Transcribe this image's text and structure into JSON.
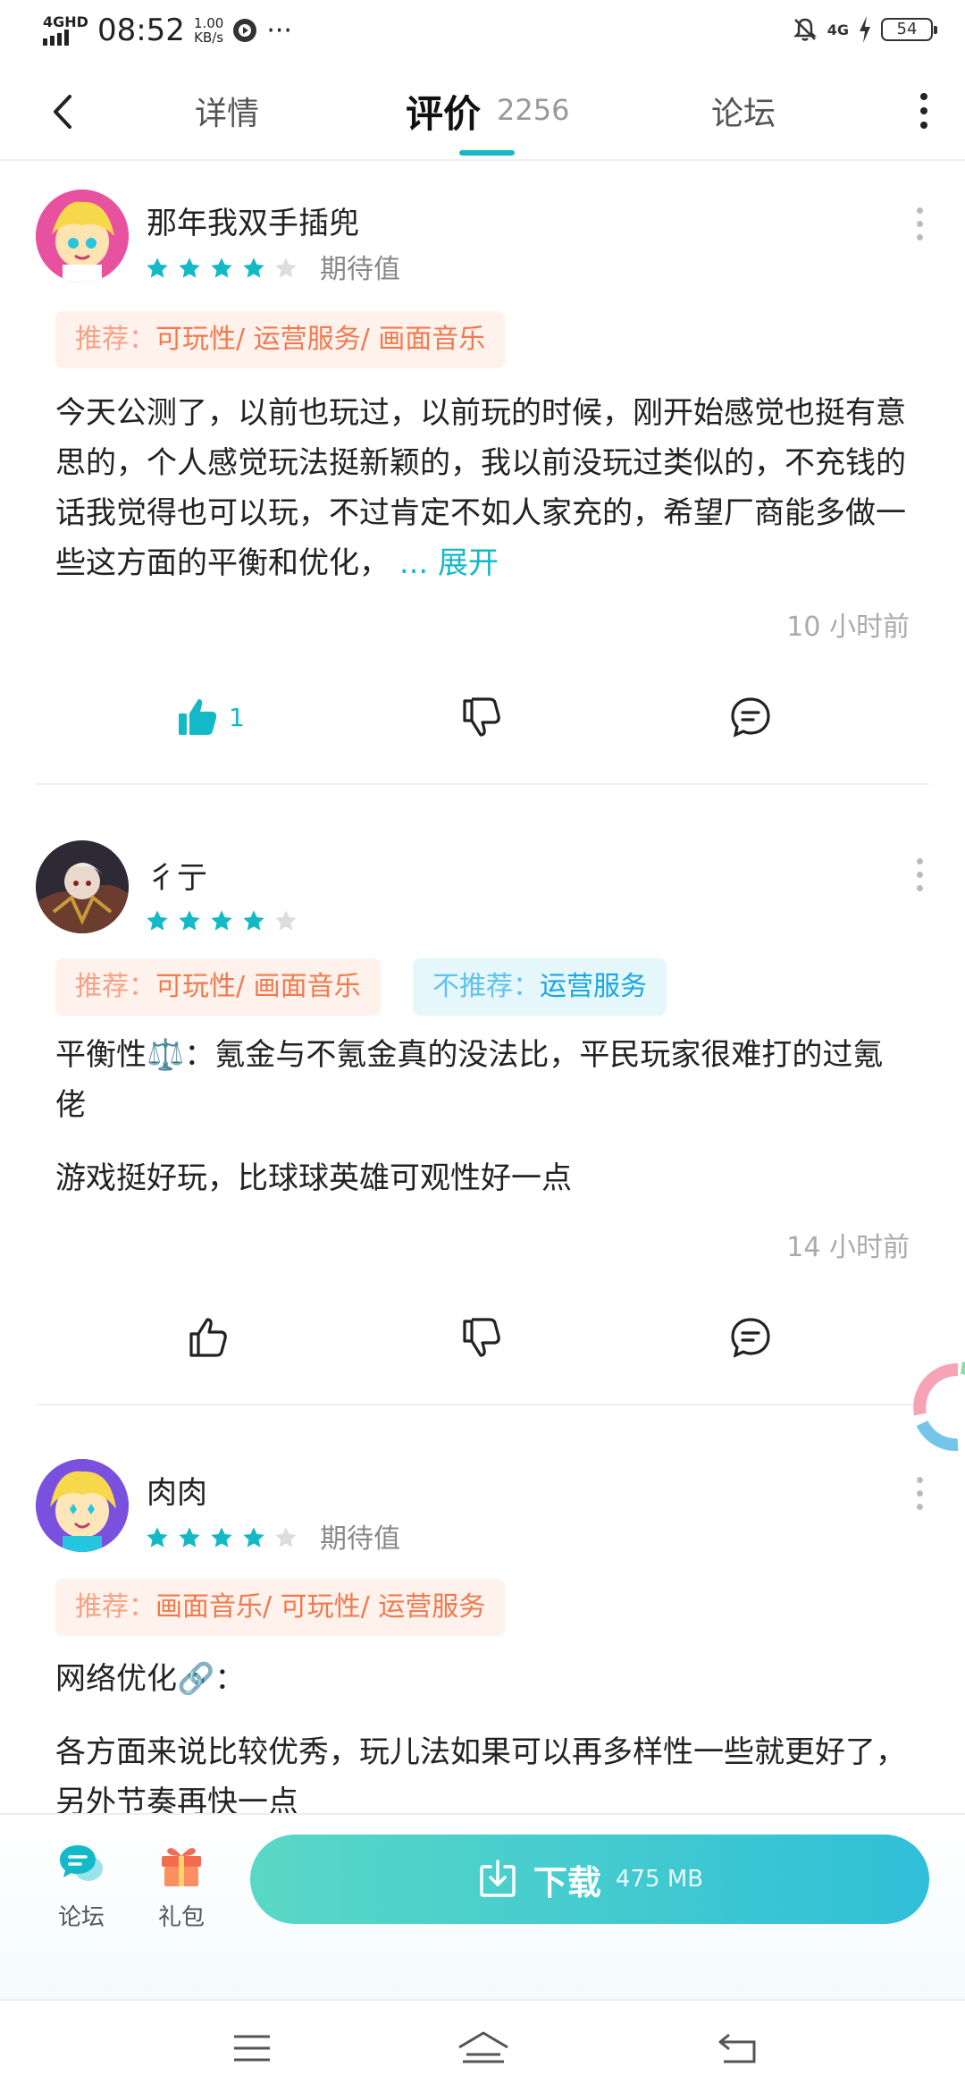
{
  "status": {
    "network": "4GHD",
    "time": "08:52",
    "speed_value": "1.00",
    "speed_unit": "KB/s",
    "more": "···",
    "signal_right": "4G",
    "battery": "54"
  },
  "nav": {
    "details": "详情",
    "reviews": "评价",
    "review_count": "2256",
    "forum": "论坛"
  },
  "reviews": [
    {
      "username": "那年我双手插兜",
      "rating": 4,
      "max_rating": 5,
      "expect": "期待值",
      "tags": [
        {
          "key": "推荐：",
          "value": "可玩性/ 运营服务/ 画面音乐"
        }
      ],
      "text": "今天公测了，以前也玩过，以前玩的时候，刚开始感觉也挺有意思的，个人感觉玩法挺新颖的，我以前没玩过类似的，不充钱的话我觉得也可以玩，不过肯定不如人家充的，希望厂商能多做一些这方面的平衡和优化，",
      "expand": "... 展开",
      "time": "10 小时前",
      "likes": "1"
    },
    {
      "username": "彳亍",
      "rating": 4,
      "max_rating": 5,
      "tags": [
        {
          "key": "推荐：",
          "value": "可玩性/ 画面音乐"
        },
        {
          "key": "不推荐：",
          "value": "运营服务"
        }
      ],
      "text1": "平衡性⚖️：氪金与不氪金真的没法比，平民玩家很难打的过氪佬",
      "text2": "游戏挺好玩，比球球英雄可观性好一点",
      "time": "14 小时前"
    },
    {
      "username": "肉肉",
      "rating": 4,
      "max_rating": 5,
      "expect": "期待值",
      "tags": [
        {
          "key": "推荐：",
          "value": "画面音乐/ 可玩性/ 运营服务"
        }
      ],
      "text1": "网络优化🔗：",
      "text2": "各方面来说比较优秀，玩儿法如果可以再多样性一些就更好了，另外节奏再快一点"
    }
  ],
  "bottom": {
    "forum": "论坛",
    "gift": "礼包",
    "download": "下载",
    "size": "475 MB"
  },
  "colors": {
    "accent": "#14b9c8",
    "recommend": "#f07a4e",
    "not_recommend": "#1aa7e0",
    "star_off": "#dddddd"
  }
}
